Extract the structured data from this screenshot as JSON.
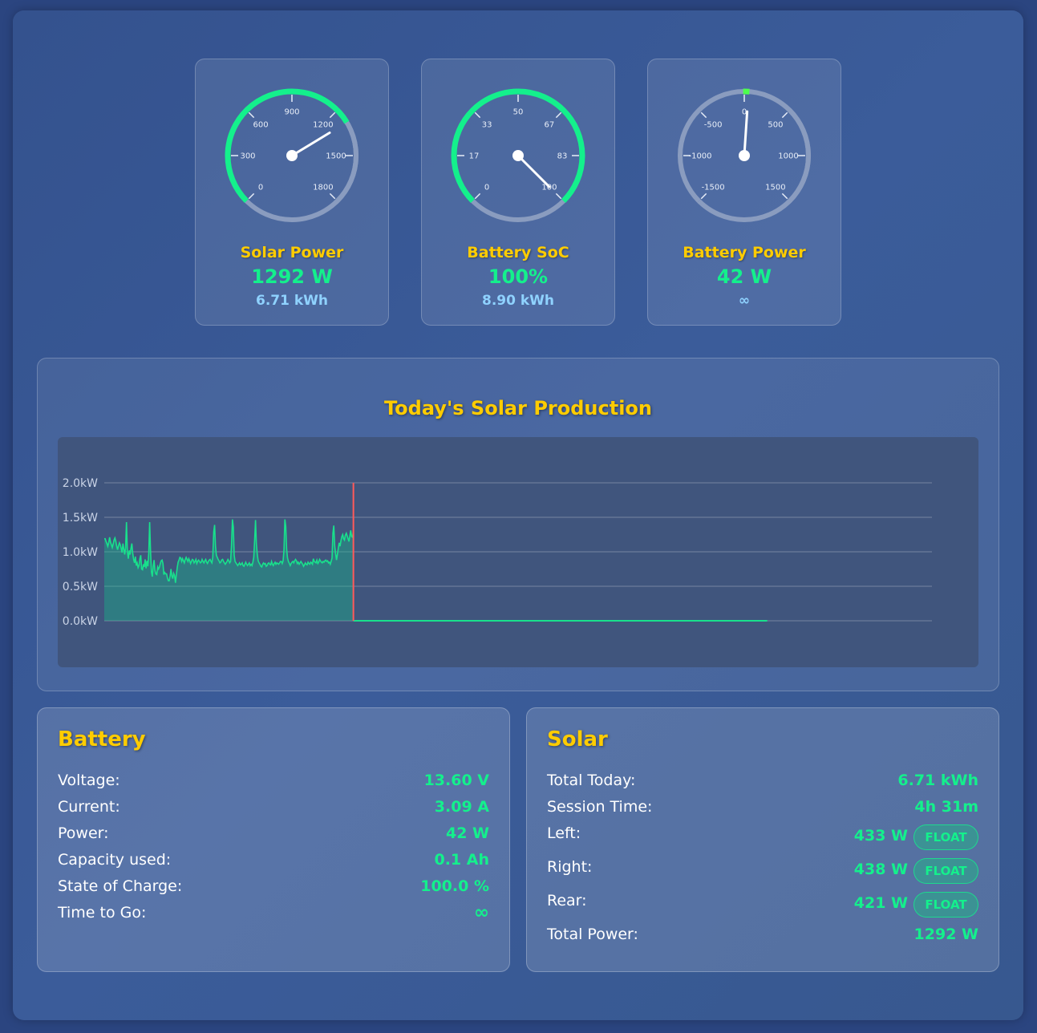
{
  "gauges": [
    {
      "title": "Solar Power",
      "value": "1292 W",
      "sub": "6.71 kWh",
      "min": 0,
      "max": 1800,
      "reading": 1292,
      "ticks": [
        "0",
        "300",
        "600",
        "900",
        "1200",
        "1500",
        "1800"
      ]
    },
    {
      "title": "Battery SoC",
      "value": "100%",
      "sub": "8.90 kWh",
      "min": 0,
      "max": 100,
      "reading": 100,
      "ticks": [
        "0",
        "17",
        "33",
        "50",
        "67",
        "83",
        "100"
      ]
    },
    {
      "title": "Battery Power",
      "value": "42 W",
      "sub": "∞",
      "min": -1500,
      "max": 1500,
      "reading": 42,
      "ticks": [
        "-1500",
        "-1000",
        "-500",
        "0",
        "500",
        "1000",
        "1500"
      ]
    }
  ],
  "chart": {
    "title": "Today's Solar Production"
  },
  "chart_data": {
    "type": "area",
    "title": "Today's Solar Production",
    "xlabel": "",
    "ylabel": "",
    "y_tick_labels": [
      "0.0kW",
      "0.5kW",
      "1.0kW",
      "1.5kW",
      "2.0kW"
    ],
    "ylim": [
      0,
      2.0
    ],
    "grid": true,
    "current_time_marker_fraction": 0.301,
    "production_end_fraction": 0.801,
    "series": [
      {
        "values": [
          1.19,
          1.19,
          1.15,
          1.12,
          1.08,
          1.13,
          1.21,
          1.14,
          1.1,
          1.06,
          1.11,
          1.17,
          1.2,
          1.15,
          1.08,
          1.03,
          1.09,
          1.13,
          1.1,
          1.05,
          0.99,
          1.12,
          1.04,
          0.96,
          1.06,
          1.43,
          1.01,
          0.9,
          1.02,
          0.96,
          1.05,
          1.12,
          0.98,
          0.89,
          0.84,
          0.93,
          0.8,
          0.84,
          0.77,
          0.8,
          0.9,
          0.95,
          0.75,
          0.74,
          0.82,
          0.78,
          0.89,
          0.76,
          0.87,
          0.79,
          0.98,
          1.43,
          1.01,
          0.71,
          0.64,
          0.79,
          0.88,
          0.73,
          0.68,
          0.67,
          0.78,
          0.75,
          0.78,
          0.83,
          0.87,
          0.88,
          0.83,
          0.67,
          0.7,
          0.68,
          0.68,
          0.62,
          0.58,
          0.58,
          0.65,
          0.75,
          0.65,
          0.61,
          0.69,
          0.66,
          0.55,
          0.67,
          0.77,
          0.85,
          0.88,
          0.92,
          0.91,
          0.86,
          0.9,
          0.87,
          0.84,
          0.89,
          0.92,
          0.89,
          0.86,
          0.9,
          0.87,
          0.83,
          0.86,
          0.89,
          0.88,
          0.84,
          0.86,
          0.89,
          0.83,
          0.86,
          0.88,
          0.86,
          0.84,
          0.85,
          0.89,
          0.86,
          0.84,
          0.87,
          0.89,
          0.85,
          0.83,
          0.86,
          0.88,
          0.89,
          0.86,
          0.84,
          0.92,
          1.29,
          1.39,
          1.08,
          0.95,
          0.92,
          0.89,
          0.87,
          0.84,
          0.85,
          0.88,
          0.89,
          0.86,
          0.84,
          0.82,
          0.84,
          0.86,
          0.89,
          0.87,
          0.84,
          0.86,
          1.08,
          1.47,
          1.36,
          0.95,
          0.86,
          0.84,
          0.82,
          0.8,
          0.82,
          0.84,
          0.81,
          0.82,
          0.84,
          0.8,
          0.79,
          0.82,
          0.85,
          0.82,
          0.8,
          0.82,
          0.84,
          0.8,
          0.82,
          0.8,
          0.85,
          0.92,
          1.17,
          1.46,
          1.11,
          0.96,
          0.87,
          0.84,
          0.82,
          0.79,
          0.78,
          0.82,
          0.84,
          0.82,
          0.83,
          0.79,
          0.8,
          0.83,
          0.84,
          0.82,
          0.81,
          0.86,
          0.82,
          0.8,
          0.83,
          0.85,
          0.82,
          0.84,
          0.83,
          0.82,
          0.84,
          0.86,
          0.86,
          0.83,
          0.87,
          1.03,
          1.47,
          1.37,
          1.04,
          0.91,
          0.86,
          0.83,
          0.8,
          0.83,
          0.85,
          0.86,
          0.84,
          0.87,
          0.89,
          0.87,
          0.83,
          0.85,
          0.82,
          0.84,
          0.86,
          0.84,
          0.82,
          0.79,
          0.81,
          0.84,
          0.82,
          0.81,
          0.85,
          0.83,
          0.82,
          0.85,
          0.84,
          0.82,
          0.9,
          0.86,
          0.85,
          0.84,
          0.88,
          0.83,
          0.85,
          0.89,
          0.87,
          0.85,
          0.84,
          0.86,
          0.85,
          0.87,
          0.88,
          0.86,
          0.87,
          0.84,
          0.85,
          0.82,
          0.86,
          0.91,
          1.27,
          1.38,
          1.09,
          0.98,
          0.88,
          0.96,
          1.05,
          1.13,
          1.08,
          1.16,
          1.22,
          1.25,
          1.19,
          1.17,
          1.24,
          1.27,
          1.23,
          1.19,
          1.15,
          1.23,
          1.31,
          1.22,
          1.21,
          1.29
        ]
      }
    ]
  },
  "battery": {
    "title": "Battery",
    "rows": [
      {
        "label": "Voltage:",
        "value": "13.60 V"
      },
      {
        "label": "Current:",
        "value": "3.09 A"
      },
      {
        "label": "Power:",
        "value": "42 W"
      },
      {
        "label": "Capacity used:",
        "value": "0.1 Ah"
      },
      {
        "label": "State of Charge:",
        "value": "100.0 %"
      },
      {
        "label": "Time to Go:",
        "value": "∞"
      }
    ]
  },
  "solar": {
    "title": "Solar",
    "total_today_label": "Total Today:",
    "total_today": "6.71 kWh",
    "session_time_label": "Session Time:",
    "session_time": "4h 31m",
    "strings": [
      {
        "label": "Left:",
        "value": "433 W",
        "state": "FLOAT"
      },
      {
        "label": "Right:",
        "value": "438 W",
        "state": "FLOAT"
      },
      {
        "label": "Rear:",
        "value": "421 W",
        "state": "FLOAT"
      }
    ],
    "total_power_label": "Total Power:",
    "total_power": "1292 W"
  },
  "colors": {
    "accent_yellow": "#ffcc00",
    "value_green": "#14f08c",
    "sub_blue": "#8fd2ff",
    "marker_red": "#ff5a5a"
  }
}
